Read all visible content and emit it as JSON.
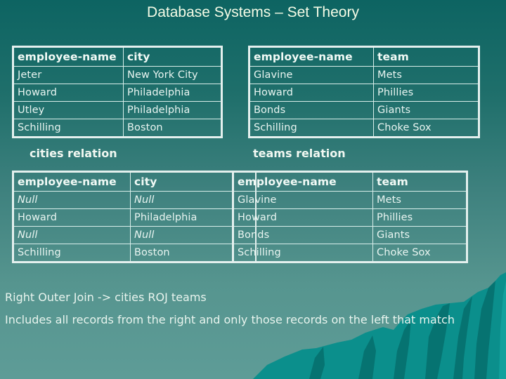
{
  "title": "Database Systems – Set Theory",
  "cities": {
    "caption": "cities relation",
    "headers": [
      "employee-name",
      "city"
    ],
    "rows": [
      [
        "Jeter",
        "New York City"
      ],
      [
        "Howard",
        "Philadelphia"
      ],
      [
        "Utley",
        "Philadelphia"
      ],
      [
        "Schilling",
        "Boston"
      ]
    ]
  },
  "teams": {
    "caption": "teams relation",
    "headers": [
      "employee-name",
      "team"
    ],
    "rows": [
      [
        "Glavine",
        "Mets"
      ],
      [
        "Howard",
        "Phillies"
      ],
      [
        "Bonds",
        "Giants"
      ],
      [
        "Schilling",
        "Choke Sox"
      ]
    ]
  },
  "result": {
    "headers": [
      "employee-name",
      "city",
      "employee-name",
      "team"
    ],
    "rows": [
      [
        "Null",
        "Null",
        "Glavine",
        "Mets"
      ],
      [
        "Howard",
        "Philadelphia",
        "Howard",
        "Phillies"
      ],
      [
        "Null",
        "Null",
        "Bonds",
        "Giants"
      ],
      [
        "Schilling",
        "Boston",
        "Schilling",
        "Choke Sox"
      ]
    ]
  },
  "description": {
    "line1": "Right Outer Join -> cities ROJ teams",
    "line2": "Includes all records from the right and only those records on the left that match"
  },
  "decoration": {
    "mountain_colors": [
      "#0b8f8c",
      "#067371",
      "#12a19d"
    ]
  }
}
